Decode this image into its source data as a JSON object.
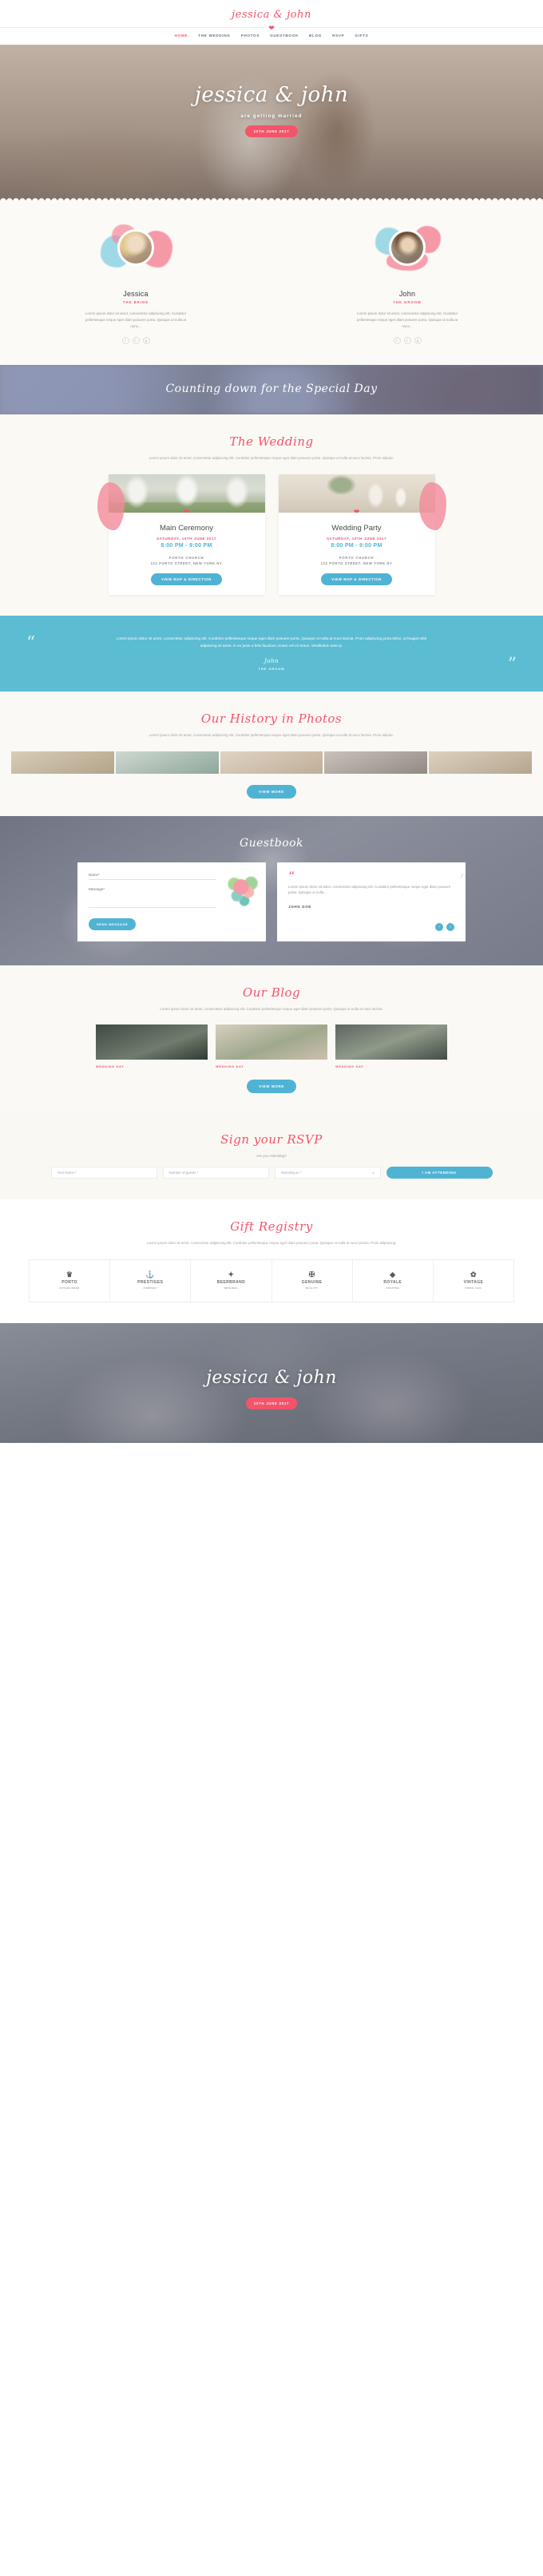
{
  "header": {
    "logo": "jessica & john",
    "heart_icon": "heart-icon",
    "nav": [
      {
        "label": "HOME",
        "active": true
      },
      {
        "label": "THE WEDDING",
        "active": false
      },
      {
        "label": "PHOTOS",
        "active": false
      },
      {
        "label": "GUESTBOOK",
        "active": false
      },
      {
        "label": "BLOG",
        "active": false
      },
      {
        "label": "RSVP",
        "active": false
      },
      {
        "label": "GIFTS",
        "active": false
      }
    ]
  },
  "hero": {
    "title": "jessica & john",
    "subtitle": "are getting married",
    "cta": "10TH JUNE 2017"
  },
  "couple": [
    {
      "name": "Jessica",
      "role": "THE BRIDE",
      "desc": "Lorem ipsum dolor sit amet, consectetur adipiscing elit. Curabitur pellentesque neque eget diam posuere porta. Quisque ut nulla at nunc...",
      "socials": [
        "f",
        "t",
        "g"
      ]
    },
    {
      "name": "John",
      "role": "THE GROOM",
      "desc": "Lorem ipsum dolor sit amet, consectetur adipiscing elit. Curabitur pellentesque neque eget diam posuere porta. Quisque ut nulla at nunc...",
      "socials": [
        "f",
        "t",
        "g"
      ]
    }
  ],
  "countdown": {
    "title": "Counting down for the Special Day"
  },
  "wedding": {
    "title": "The Wedding",
    "desc": "Lorem ipsum dolor sit amet, consectetur adipiscing elit. Curabitur pellentesque neque eget diam posuere porta. Quisque ut nulla at nunc lacinia. Proin adipisc.",
    "cards": [
      {
        "title": "Main Ceremony",
        "date": "SATURDAY, 10TH JUNE 2017",
        "time": "8:00 PM - 9:00 PM",
        "venue": "PORTO CHURCH",
        "address": "123 PORTO STREET, NEW YORK NY",
        "button": "VIEW MAP & DIRECTION"
      },
      {
        "title": "Wedding Party",
        "date": "SATURDAY, 10TH JUNE 2017",
        "time": "8:00 PM - 9:00 PM",
        "venue": "PORTO CHURCH",
        "address": "123 PORTO STREET, NEW YORK NY",
        "button": "VIEW MAP & DIRECTION"
      }
    ]
  },
  "quote": {
    "text": "Lorem ipsum dolor sit amet, consectetur adipiscing elit. Curabitur pellentesque neque eget diam posuere porta. Quisque ut nulla at nunc lacinia. Proin adipiscing porta tellus, ut feugiat nibh adipiscing sit amet. In eu justo a felis faucibus ornare vel id metus. Vestibulum ante ip.",
    "author": "John",
    "role": "THE GROOM"
  },
  "photos": {
    "title": "Our History in Photos",
    "desc": "Lorem ipsum dolor sit amet, consectetur adipiscing elit. Curabitur pellentesque neque eget diam posuere porta. Quisque ut nulla at nunc lacinia. Proin adipisc.",
    "button": "VIEW MORE"
  },
  "guestbook": {
    "title": "Guestbook",
    "form": {
      "name_label": "Name*",
      "message_label": "Message*",
      "submit": "SEND MESSAGE"
    },
    "entry": {
      "text": "Lorem ipsum dolor sit amet, consectetur adipiscing elit. Curabitur pellentesque neque eget diam posuere porta. Quisque ut nulla...",
      "author": "JOHN DOE"
    },
    "prev_icon": "chevron-left-icon",
    "next_icon": "chevron-right-icon"
  },
  "blog": {
    "title": "Our Blog",
    "desc": "Lorem ipsum dolor sit amet, consectetur adipiscing elit. Curabitur pellentesque neque eget diam posuere porta. Quisque ut nulla at nunc lacinia.",
    "posts": [
      {
        "tag": "WEDDING DAY"
      },
      {
        "tag": "WEDDING DAY"
      },
      {
        "tag": "WEDDING DAY"
      }
    ],
    "button": "VIEW MORE"
  },
  "rsvp": {
    "title": "Sign your RSVP",
    "question": "Are you Attending?",
    "name_placeholder": "Your Name *",
    "guests_placeholder": "Number of guests *",
    "attending_placeholder": "Attending to *",
    "submit": "I AM ATTENDING"
  },
  "gifts": {
    "title": "Gift Registry",
    "desc": "Lorem ipsum dolor sit amet, consectetur adipiscing elit. Curabitur pellentesque neque eget diam posuere porta. Quisque ut nulla at nunc lacinia. Proin adipiscing.",
    "brands": [
      {
        "symbol": "♛",
        "name": "PORTO",
        "sub": "ESTABLISHED"
      },
      {
        "symbol": "⚓",
        "name": "PRESTIGES",
        "sub": "COMPANY"
      },
      {
        "symbol": "✦",
        "name": "BEERBRAND",
        "sub": "ORIGINAL"
      },
      {
        "symbol": "✠",
        "name": "GENUINE",
        "sub": "QUALITY"
      },
      {
        "symbol": "◆",
        "name": "ROYALE",
        "sub": "CRAFTED"
      },
      {
        "symbol": "✿",
        "name": "VINTAGE",
        "sub": "SINCE 1920"
      }
    ]
  },
  "footer": {
    "title": "jessica & john",
    "badge": "10TH JUNE 2017"
  },
  "colors": {
    "pink": "#f4546a",
    "teal": "#4fb3d4",
    "quote_bg": "#5bbcd2",
    "text_dark": "#4a4a4a",
    "text_muted": "#9a9a9a"
  }
}
